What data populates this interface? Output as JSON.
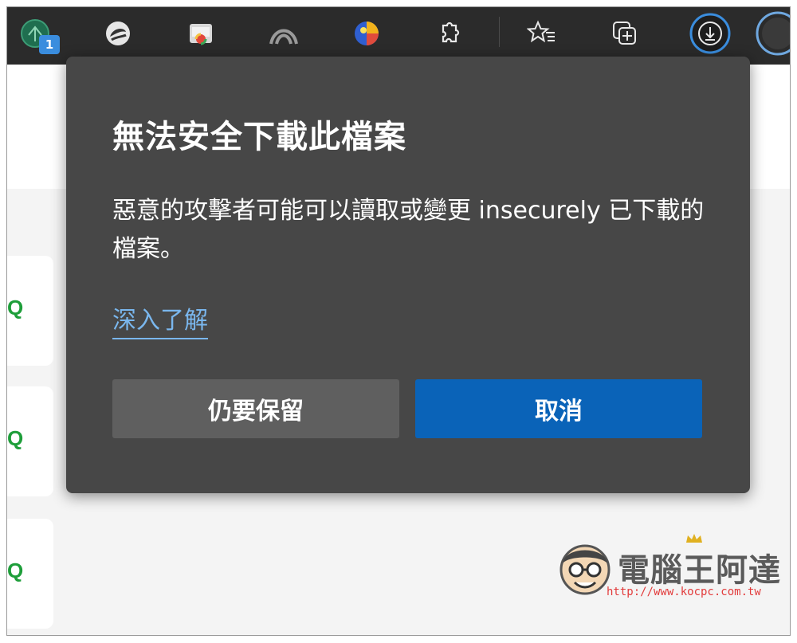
{
  "toolbar": {
    "tab_badge": "1",
    "icons": [
      "extension-green-icon",
      "swirl-extension-icon",
      "image-extension-icon",
      "arch-extension-icon",
      "colorful-extension-icon",
      "puzzle-extensions-icon",
      "favorites-icon",
      "collections-icon",
      "download-icon",
      "profile-icon"
    ]
  },
  "dialog": {
    "title": "無法安全下載此檔案",
    "message": "惡意的攻擊者可能可以讀取或變更 insecurely 已下載的檔案。",
    "learn_more": "深入了解",
    "keep_label": "仍要保留",
    "cancel_label": "取消"
  },
  "page": {
    "card_glyph": "Q"
  },
  "watermark": {
    "title": "電腦王阿達",
    "url": "http://www.kocpc.com.tw"
  },
  "colors": {
    "toolbar_bg": "#2b2b2b",
    "dialog_bg": "#474747",
    "primary_button": "#0a63b8",
    "secondary_button": "#5f5f5f",
    "link": "#7ab7ee",
    "download_accent": "#3a8dde"
  }
}
